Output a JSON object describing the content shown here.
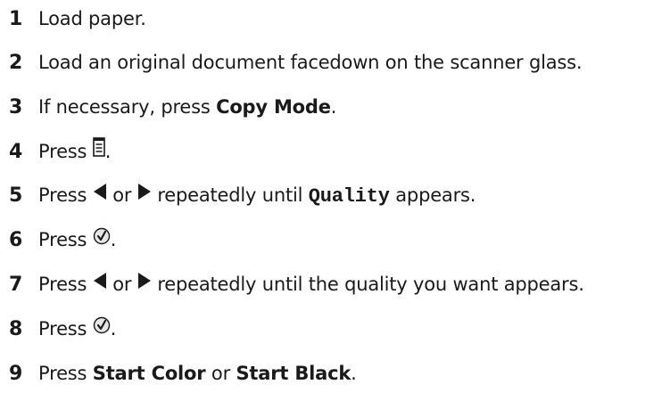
{
  "steps": [
    {
      "number": "1",
      "text": "Load paper."
    },
    {
      "number": "2",
      "text": "Load an original document facedown on the scanner glass."
    },
    {
      "number": "3",
      "pre": "If necessary, press",
      "bold": "Copy Mode",
      "post": "."
    },
    {
      "number": "4",
      "pre": "Press",
      "icon": "menu-icon",
      "post": "."
    },
    {
      "number": "5",
      "pre": "Press",
      "icon_left": "left-arrow-icon",
      "mid1": "or",
      "icon_right": "right-arrow-icon",
      "mid2": "repeatedly until",
      "mono": "Quality",
      "post": "appears."
    },
    {
      "number": "6",
      "pre": "Press",
      "icon": "select-checkmark-icon",
      "post": "."
    },
    {
      "number": "7",
      "pre": "Press",
      "icon_left": "left-arrow-icon",
      "mid1": "or",
      "icon_right": "right-arrow-icon",
      "post": "repeatedly until the quality you want appears."
    },
    {
      "number": "8",
      "pre": "Press",
      "icon": "select-checkmark-icon",
      "post": "."
    },
    {
      "number": "9",
      "pre": "Press",
      "bold1": "Start Color",
      "mid": "or",
      "bold2": "Start Black",
      "post": "."
    }
  ]
}
